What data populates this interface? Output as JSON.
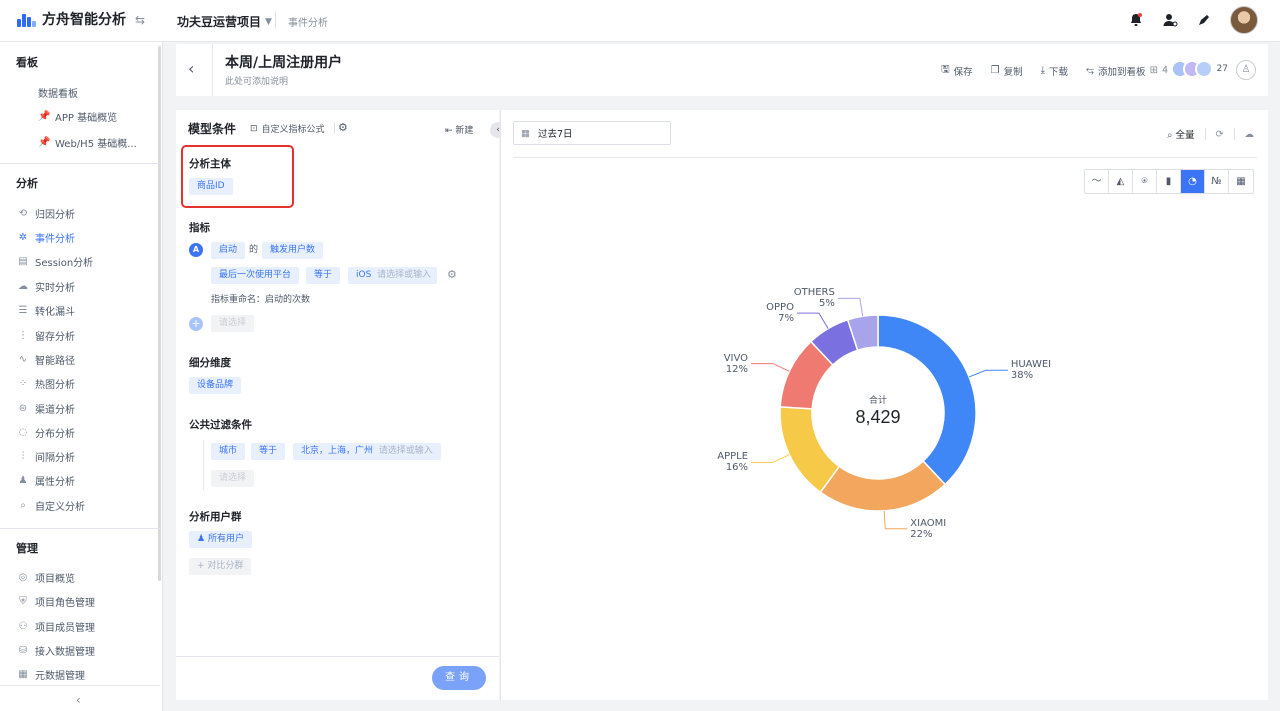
{
  "app": {
    "name": "方舟智能分析",
    "project": "功夫豆运营项目",
    "breadcrumb": "事件分析"
  },
  "sidebar": {
    "sections": [
      {
        "title": "看板",
        "items": [
          {
            "label": "数据看板",
            "icon": "none"
          },
          {
            "label": "APP 基础概览",
            "icon": "pin-icon"
          },
          {
            "label": "Web/H5 基础概...",
            "icon": "pin-icon"
          }
        ]
      },
      {
        "title": "分析",
        "items": [
          {
            "label": "归因分析",
            "icon": "attribution-icon"
          },
          {
            "label": "事件分析",
            "icon": "event-icon",
            "active": true
          },
          {
            "label": "Session分析",
            "icon": "session-icon"
          },
          {
            "label": "实时分析",
            "icon": "realtime-icon"
          },
          {
            "label": "转化漏斗",
            "icon": "funnel-icon"
          },
          {
            "label": "留存分析",
            "icon": "retention-icon"
          },
          {
            "label": "智能路径",
            "icon": "path-icon"
          },
          {
            "label": "热图分析",
            "icon": "heatmap-icon"
          },
          {
            "label": "渠道分析",
            "icon": "channel-icon"
          },
          {
            "label": "分布分析",
            "icon": "distribution-icon"
          },
          {
            "label": "间隔分析",
            "icon": "interval-icon"
          },
          {
            "label": "属性分析",
            "icon": "attribute-icon"
          },
          {
            "label": "自定义分析",
            "icon": "custom-search-icon"
          }
        ]
      },
      {
        "title": "管理",
        "items": [
          {
            "label": "项目概览",
            "icon": "overview-icon"
          },
          {
            "label": "项目角色管理",
            "icon": "role-icon"
          },
          {
            "label": "项目成员管理",
            "icon": "members-icon"
          },
          {
            "label": "接入数据管理",
            "icon": "data-access-icon"
          },
          {
            "label": "元数据管理",
            "icon": "metadata-icon"
          }
        ]
      }
    ]
  },
  "header": {
    "title": "本周/上周注册用户",
    "subtitle": "此处可添加说明",
    "actions": {
      "save": "保存",
      "copy": "复制",
      "download": "下载",
      "add_to_board": "添加到看板",
      "board_count": "4"
    },
    "collaborators_count": "27"
  },
  "model": {
    "title": "模型条件",
    "formula": "自定义指标公式",
    "new_label": "新建",
    "subject_label": "分析主体",
    "subject_value": "商品ID",
    "metric_label": "指标",
    "metric": {
      "badge": "A",
      "event": "启动",
      "of": "的",
      "measure": "触发用户数"
    },
    "filter": {
      "property": "最后一次使用平台",
      "op": "等于",
      "value": "iOS",
      "placeholder": "请选择或输入"
    },
    "rename": "指标重命名：启动的次数",
    "add_placeholder": "请选择",
    "dimension_label": "细分维度",
    "dimension_value": "设备品牌",
    "public_filter_label": "公共过滤条件",
    "public_filter": {
      "property": "城市",
      "op": "等于",
      "value": "北京，上海，广州",
      "placeholder": "请选择或输入",
      "add_placeholder": "请选择"
    },
    "group_label": "分析用户群",
    "group_value": "所有用户",
    "compare_label": "+ 对比分群",
    "query_label": "查询"
  },
  "chart_toolbar": {
    "date_range": "过去7日",
    "fullscreen": "全量",
    "types": [
      "line-chart-icon",
      "area-chart-icon",
      "funnel-chart-icon",
      "bar-chart-icon",
      "pie-chart-icon",
      "number-icon",
      "table-icon"
    ],
    "active_type": "pie-chart-icon",
    "number_glyph": "№"
  },
  "chart_data": {
    "type": "pie",
    "donut": true,
    "center_label": "合计",
    "center_value": "8,429",
    "categories": [
      "HUAWEI",
      "XIAOMI",
      "APPLE",
      "VIVO",
      "OPPO",
      "OTHERS"
    ],
    "values": [
      38,
      22,
      16,
      12,
      7,
      5
    ],
    "labels": [
      "38%",
      "22%",
      "16%",
      "12%",
      "7%",
      "5%"
    ],
    "colors": [
      "#3f86f7",
      "#f2a65e",
      "#f7c948",
      "#ef7a72",
      "#7b70e0",
      "#a8a4ec"
    ]
  }
}
